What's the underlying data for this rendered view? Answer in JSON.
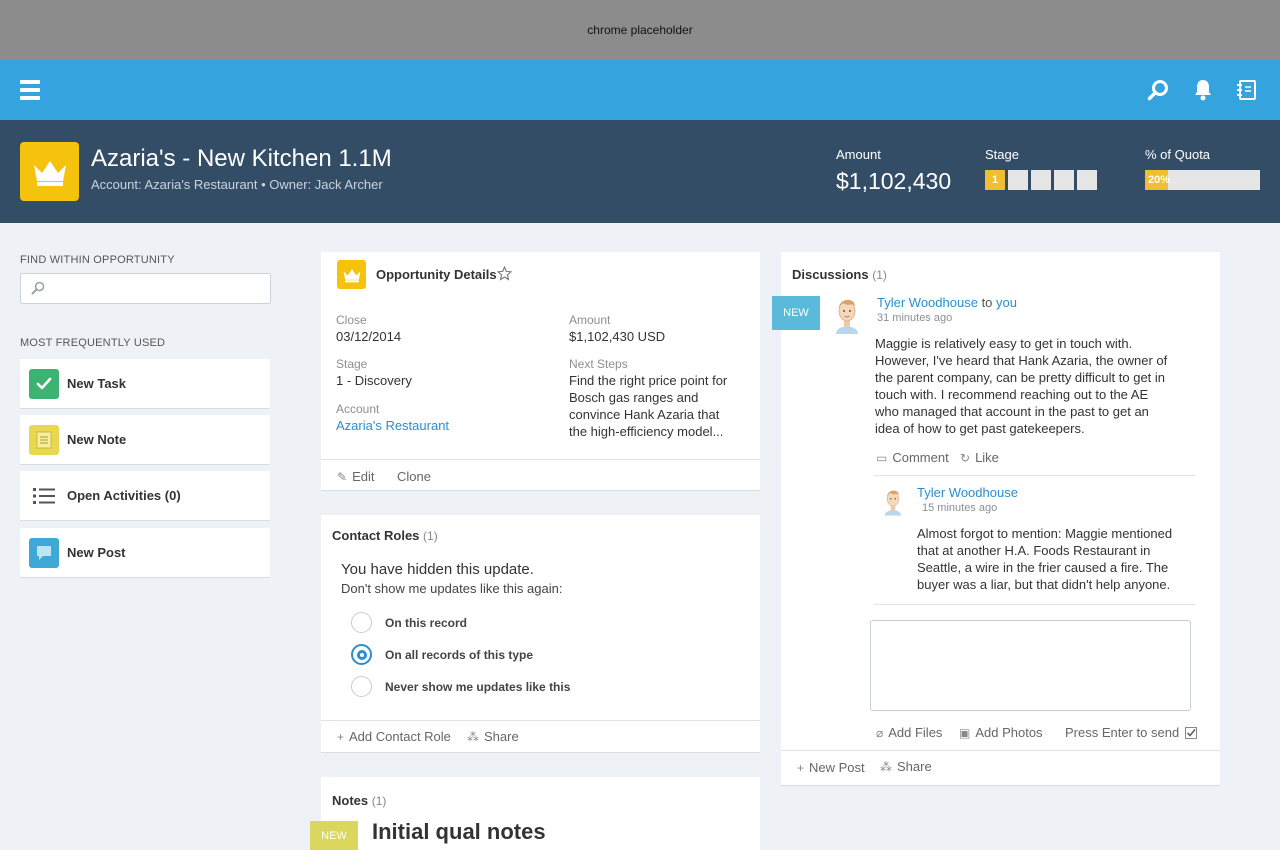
{
  "chrome": {
    "label": "chrome placeholder"
  },
  "topbar": {
    "icons": [
      "menu-icon",
      "search-icon",
      "bell-icon",
      "notebook-icon"
    ]
  },
  "header": {
    "title": "Azaria's - New Kitchen 1.1M",
    "subtitle": "Account: Azaria's Restaurant • Owner: Jack Archer",
    "amount_label": "Amount",
    "amount_value": "$1,102,430",
    "stage_label": "Stage",
    "stage_current": "1",
    "stage_total": 5,
    "quota_label": "% of Quota",
    "quota_value": "20%",
    "quota_fraction": 0.2,
    "colors": {
      "header_bg": "#344d66",
      "topbar_bg": "#35a4de",
      "accent": "#f0be33"
    }
  },
  "left": {
    "find_label": "FIND WITHIN OPPORTUNITY",
    "search_placeholder": "",
    "freq_label": "MOST FREQUENTLY USED",
    "actions": [
      {
        "label": "New Task",
        "icon": "checkmark-icon",
        "color": "#3cb371"
      },
      {
        "label": "New Note",
        "icon": "note-icon",
        "color": "#e7d84f"
      },
      {
        "label": "Open Activities (0)",
        "icon": "list-icon",
        "color": "#ffffff"
      },
      {
        "label": "New Post",
        "icon": "speech-bubble-icon",
        "color": "#3fa8d6"
      }
    ]
  },
  "details": {
    "title": "Opportunity Details",
    "close_label": "Close",
    "close_value": "03/12/2014",
    "amount_label": "Amount",
    "amount_value": "$1,102,430 USD",
    "stage_label": "Stage",
    "stage_value": "1 - Discovery",
    "next_label": "Next Steps",
    "next_value_lines": [
      "Find the right price point for",
      "Bosch gas ranges and",
      "convince Hank Azaria that",
      "the high-efficiency model..."
    ],
    "account_label": "Account",
    "account_value": "Azaria's Restaurant",
    "edit_label": "Edit",
    "clone_label": "Clone"
  },
  "contact_roles": {
    "title": "Contact Roles",
    "count": "(1)",
    "hidden_title": "You have hidden this update.",
    "hidden_sub": "Don't show me updates like this again:",
    "options": [
      "On this record",
      "On all records of this type",
      "Never show me updates like this"
    ],
    "selected_index": 1,
    "add_label": "Add Contact Role",
    "share_label": "Share"
  },
  "notes": {
    "title": "Notes",
    "count": "(1)",
    "new_flag": "NEW",
    "note_title": "Initial qual notes"
  },
  "discussions": {
    "title": "Discussions",
    "count": "(1)",
    "new_flag": "NEW",
    "post": {
      "author": "Tyler Woodhouse",
      "to_word": "to",
      "recipient": "you",
      "time": "31 minutes ago",
      "body_lines": [
        "Maggie is relatively easy to get in touch with.",
        "However, I've heard that Hank Azaria, the owner of",
        "the parent company, can be pretty difficult to get in",
        "touch with. I recommend reaching out to the AE",
        "who managed that account in the past to get an",
        "idea of how to get past gatekeepers."
      ],
      "comment_label": "Comment",
      "like_label": "Like"
    },
    "reply": {
      "author": "Tyler Woodhouse",
      "time": "15 minutes ago",
      "body_lines": [
        "Almost forgot to mention: Maggie mentioned",
        "that at another H.A. Foods Restaurant in",
        "Seattle, a wire in the frier caused a fire. The",
        "buyer was a liar, but that didn't help anyone."
      ]
    },
    "reply_placeholder": "",
    "add_files_label": "Add Files",
    "add_photos_label": "Add Photos",
    "enter_send_label": "Press Enter to send",
    "new_post_label": "New Post",
    "share_label": "Share"
  }
}
